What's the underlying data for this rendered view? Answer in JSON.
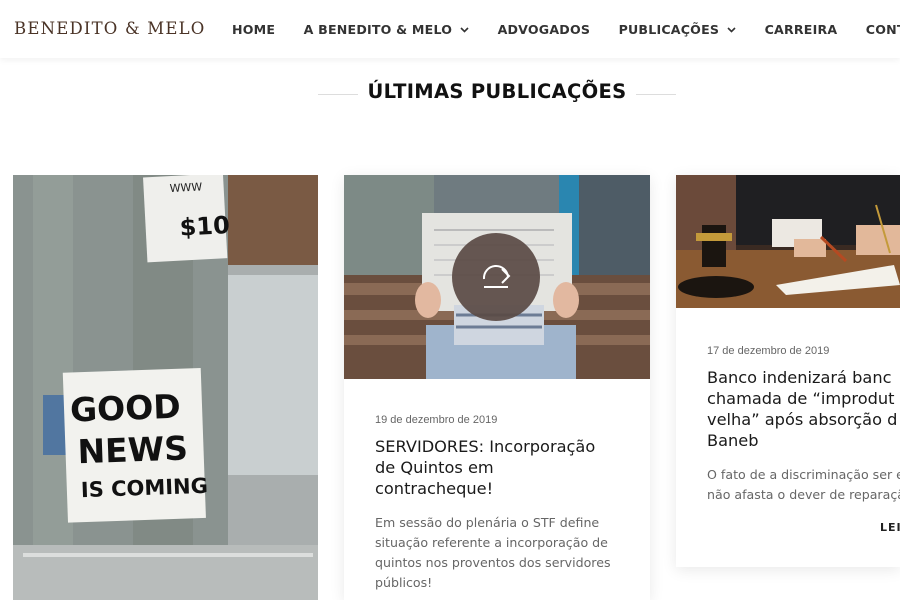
{
  "header": {
    "logo": "BENEDITO & MELO",
    "nav": [
      {
        "label": "HOME"
      },
      {
        "label": "A BENEDITO & MELO",
        "dropdown": true
      },
      {
        "label": "ADVOGADOS"
      },
      {
        "label": "PUBLICAÇÕES",
        "dropdown": true
      },
      {
        "label": "CARREIRA"
      },
      {
        "label": "CONTATO"
      }
    ]
  },
  "section": {
    "title": "ÚLTIMAS PUBLICAÇÕES"
  },
  "poster": {
    "line1": "GOOD",
    "line2": "NEWS",
    "line3": "IS COMING",
    "top_sign": "WWW",
    "price": "$10"
  },
  "cards": [
    {
      "date": "19 de dezembro de 2019",
      "title_lines": [
        "SERVIDORES: Incorporação",
        "de Quintos em",
        "contracheque!"
      ],
      "excerpt_lines": [
        "Em sessão do plenária o STF define",
        "situação referente a incorporação de",
        "quintos nos proventos dos servidores",
        "públicos!"
      ]
    },
    {
      "date": "17 de dezembro de 2019",
      "title_lines": [
        "Banco indenizará banc",
        "chamada de “improdut",
        "velha” após absorção d",
        "Baneb"
      ],
      "excerpt_lines": [
        "O fato de a discriminação ser en",
        "não afasta o dever de reparação"
      ],
      "read_more": "LEIA"
    }
  ],
  "colors": {
    "brand": "#4a3326",
    "overlay": "#5a4a44"
  },
  "icons": {
    "chevron": "chevron-down-icon",
    "reload": "reload-icon"
  }
}
